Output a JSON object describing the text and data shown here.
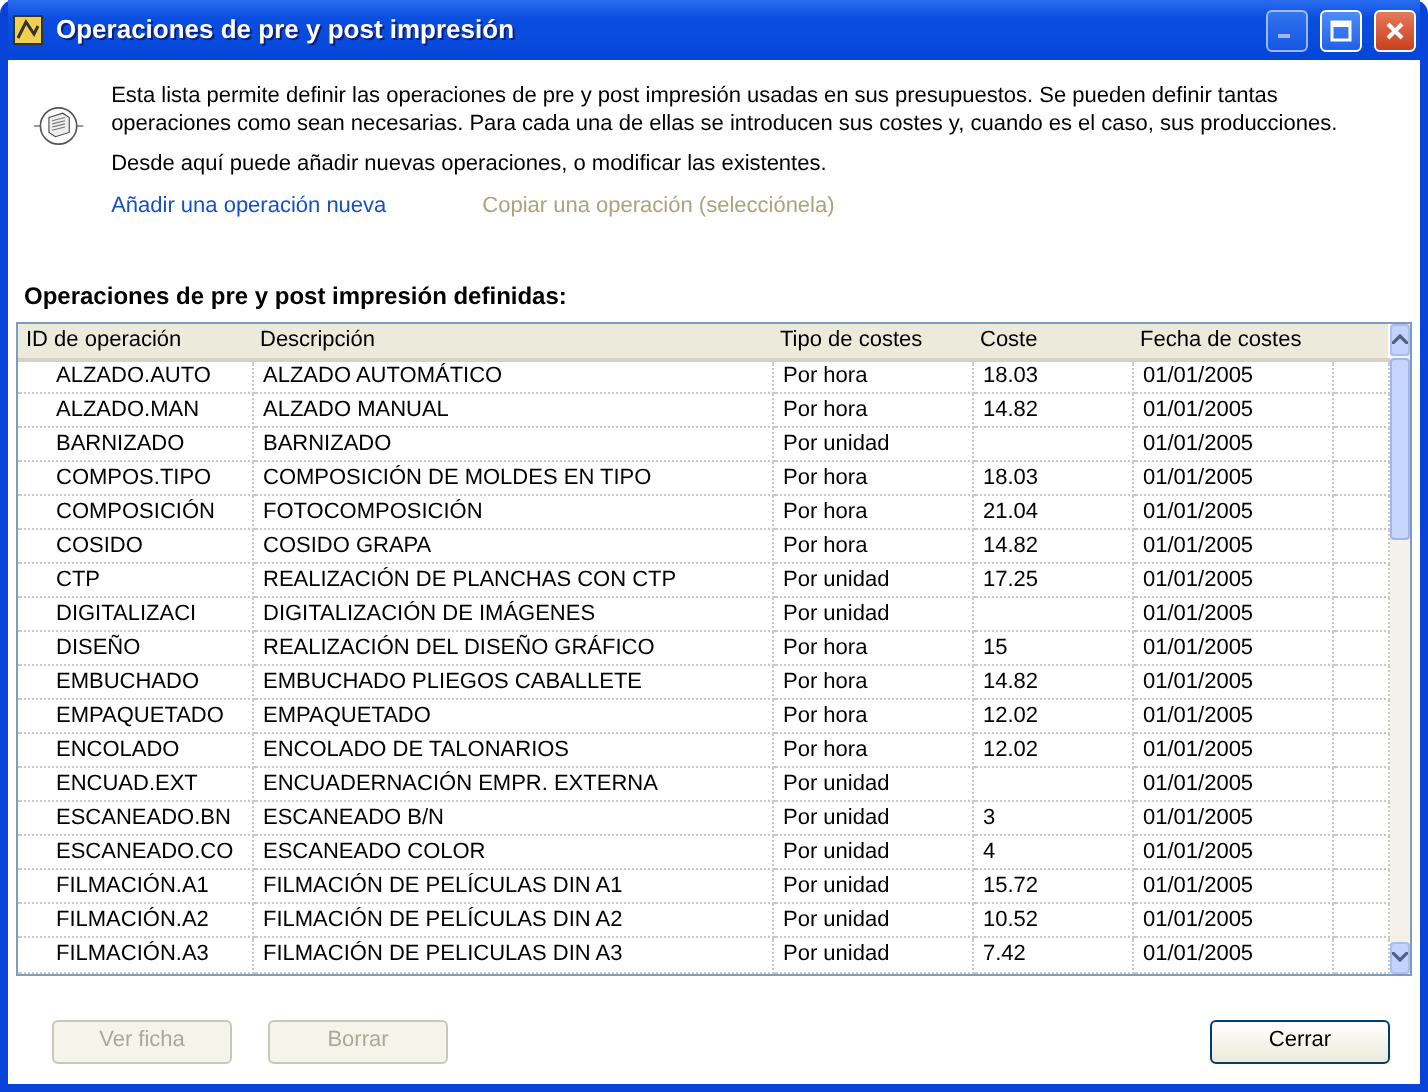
{
  "window": {
    "title": "Operaciones de pre y post impresión"
  },
  "intro": {
    "paragraphs": [
      "Esta lista permite definir las operaciones de pre y post impresión usadas en sus presupuestos. Se pueden definir tantas operaciones como sean necesarias. Para cada una de ellas se introducen sus costes y, cuando es el caso, sus producciones.",
      "Desde aquí puede añadir nuevas operaciones, o modificar las existentes."
    ]
  },
  "links": [
    {
      "label": "Añadir una operación nueva",
      "disabled": false
    },
    {
      "label": "Copiar una operación (selecciónela)",
      "disabled": true
    }
  ],
  "section_title": "Operaciones de pre y post impresión definidas:",
  "table": {
    "columns": [
      "ID de operación",
      "Descripción",
      "Tipo de costes",
      "Coste",
      "Fecha de costes"
    ],
    "rows": [
      {
        "id": "ALZADO.AUTO",
        "description": "ALZADO AUTOMÁTICO",
        "cost_type": "Por hora",
        "cost": "18.03",
        "cost_date": "01/01/2005"
      },
      {
        "id": "ALZADO.MAN",
        "description": "ALZADO MANUAL",
        "cost_type": "Por hora",
        "cost": "14.82",
        "cost_date": "01/01/2005"
      },
      {
        "id": "BARNIZADO",
        "description": "BARNIZADO",
        "cost_type": "Por unidad",
        "cost_date": "01/01/2005"
      },
      {
        "id": "COMPOS.TIPO",
        "description": "COMPOSICIÓN DE MOLDES EN TIPO",
        "cost_type": "Por hora",
        "cost": "18.03",
        "cost_date": "01/01/2005"
      },
      {
        "id": "COMPOSICIÓN",
        "description": "FOTOCOMPOSICIÓN",
        "cost_type": "Por hora",
        "cost": "21.04",
        "cost_date": "01/01/2005"
      },
      {
        "id": "COSIDO",
        "description": "COSIDO GRAPA",
        "cost_type": "Por hora",
        "cost": "14.82",
        "cost_date": "01/01/2005"
      },
      {
        "id": "CTP",
        "description": "REALIZACIÓN DE PLANCHAS CON CTP",
        "cost_type": "Por unidad",
        "cost": "17.25",
        "cost_date": "01/01/2005"
      },
      {
        "id": "DIGITALIZACI",
        "description": "DIGITALIZACIÓN DE IMÁGENES",
        "cost_type": "Por unidad",
        "cost_date": "01/01/2005"
      },
      {
        "id": "DISEÑO",
        "description": "REALIZACIÓN DEL DISEÑO GRÁFICO",
        "cost_type": "Por hora",
        "cost": "15",
        "cost_date": "01/01/2005"
      },
      {
        "id": "EMBUCHADO",
        "description": "EMBUCHADO PLIEGOS CABALLETE",
        "cost_type": "Por hora",
        "cost": "14.82",
        "cost_date": "01/01/2005"
      },
      {
        "id": "EMPAQUETADO",
        "description": "EMPAQUETADO",
        "cost_type": "Por hora",
        "cost": "12.02",
        "cost_date": "01/01/2005"
      },
      {
        "id": "ENCOLADO",
        "description": "ENCOLADO DE TALONARIOS",
        "cost_type": "Por hora",
        "cost": "12.02",
        "cost_date": "01/01/2005"
      },
      {
        "id": "ENCUAD.EXT",
        "description": "ENCUADERNACIÓN EMPR. EXTERNA",
        "cost_type": "Por unidad",
        "cost_date": "01/01/2005"
      },
      {
        "id": "ESCANEADO.BN",
        "description": "ESCANEADO B/N",
        "cost_type": "Por unidad",
        "cost": "3",
        "cost_date": "01/01/2005"
      },
      {
        "id": "ESCANEADO.CO",
        "description": "ESCANEADO COLOR",
        "cost_type": "Por unidad",
        "cost": "4",
        "cost_date": "01/01/2005"
      },
      {
        "id": "FILMACIÓN.A1",
        "description": "FILMACIÓN DE PELÍCULAS DIN A1",
        "cost_type": "Por unidad",
        "cost": "15.72",
        "cost_date": "01/01/2005"
      },
      {
        "id": "FILMACIÓN.A2",
        "description": "FILMACIÓN DE PELÍCULAS DIN A2",
        "cost_type": "Por unidad",
        "cost": "10.52",
        "cost_date": "01/01/2005"
      },
      {
        "id": "FILMACIÓN.A3",
        "description": "FILMACIÓN DE PELICULAS DIN A3",
        "cost_type": "Por unidad",
        "cost": "7.42",
        "cost_date": "01/01/2005"
      }
    ]
  },
  "buttons": [
    {
      "label": "Ver ficha",
      "disabled": true
    },
    {
      "label": "Borrar",
      "disabled": true
    },
    {
      "label": "Cerrar",
      "disabled": false
    }
  ]
}
